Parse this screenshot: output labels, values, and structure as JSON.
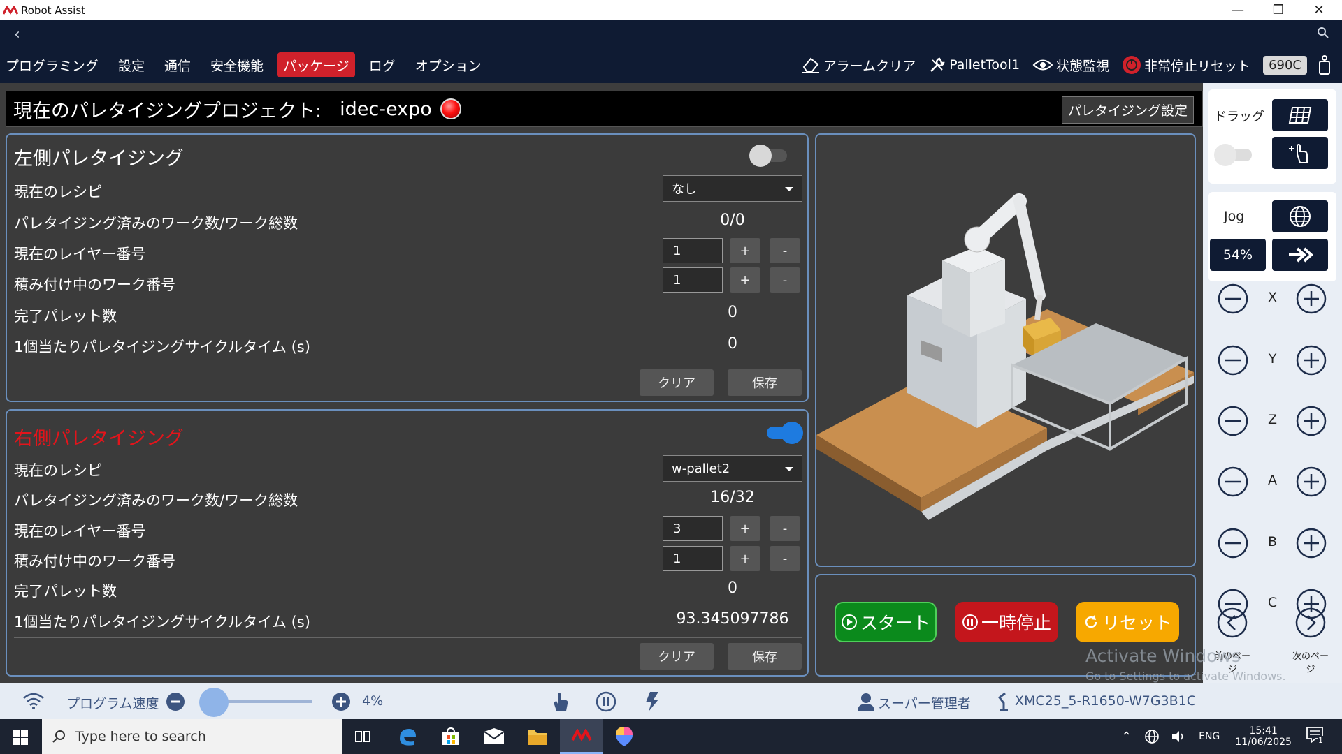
{
  "window": {
    "title": "Robot Assist"
  },
  "menu": {
    "items": [
      "プログラミング",
      "設定",
      "通信",
      "安全機能",
      "パッケージ",
      "ログ",
      "オプション"
    ],
    "active": "パッケージ",
    "right": {
      "alarm_clear": "アラームクリア",
      "tool": "PalletTool1",
      "monitor": "状態監視",
      "estop_reset": "非常停止リセット",
      "model": "690C"
    }
  },
  "project": {
    "label": "現在のパレタイジングプロジェクト:",
    "name": "idec-expo",
    "settings_button": "パレタイジング設定"
  },
  "left_panel": {
    "title": "左側パレタイジング",
    "enabled": false,
    "recipe_label": "現在のレシピ",
    "recipe_value": "なし",
    "count_label": "パレタイジング済みのワーク数/ワーク総数",
    "count_value": "0/0",
    "layer_label": "現在のレイヤー番号",
    "layer_value": "1",
    "work_label": "積み付け中のワーク番号",
    "work_value": "1",
    "done_label": "完了パレット数",
    "done_value": "0",
    "cycle_label": "1個当たりパレタイジングサイクルタイム (s)",
    "cycle_value": "0",
    "clear": "クリア",
    "save": "保存",
    "plus": "+",
    "minus": "-"
  },
  "right_panel": {
    "title": "右側パレタイジング",
    "enabled": true,
    "recipe_label": "現在のレシピ",
    "recipe_value": "w-pallet2",
    "count_label": "パレタイジング済みのワーク数/ワーク総数",
    "count_value": "16/32",
    "layer_label": "現在のレイヤー番号",
    "layer_value": "3",
    "work_label": "積み付け中のワーク番号",
    "work_value": "1",
    "done_label": "完了パレット数",
    "done_value": "0",
    "cycle_label": "1個当たりパレタイジングサイクルタイム (s)",
    "cycle_value": "93.345097786",
    "clear": "クリア",
    "save": "保存",
    "plus": "+",
    "minus": "-"
  },
  "controls": {
    "start": "スタート",
    "pause": "一時停止",
    "reset": "リセット"
  },
  "jog": {
    "drag_label": "ドラッグ",
    "jog_label": "Jog",
    "speed": "54%",
    "axes": [
      "X",
      "Y",
      "Z",
      "A",
      "B",
      "C"
    ],
    "prev_page": "前のページ",
    "next_page": "次のページ"
  },
  "status": {
    "speed_label": "プログラム速度",
    "speed_value": "4%",
    "speed_fraction": 0.04,
    "user": "スーパー管理者",
    "device": "XMC25_5-R1650-W7G3B1C"
  },
  "watermark": {
    "line1": "Activate Windows",
    "line2": "Go to Settings to activate Windows."
  },
  "taskbar": {
    "search_placeholder": "Type here to search",
    "lang": "ENG",
    "time": "15:41",
    "date": "11/06/2025",
    "notifications": "1"
  },
  "colors": {
    "nav": "#0f1b33",
    "active_tab": "#d0212b",
    "start": "#0b8a1c",
    "pause": "#c4161c",
    "reset": "#f7a800",
    "toggle_on": "#1e7be0"
  }
}
